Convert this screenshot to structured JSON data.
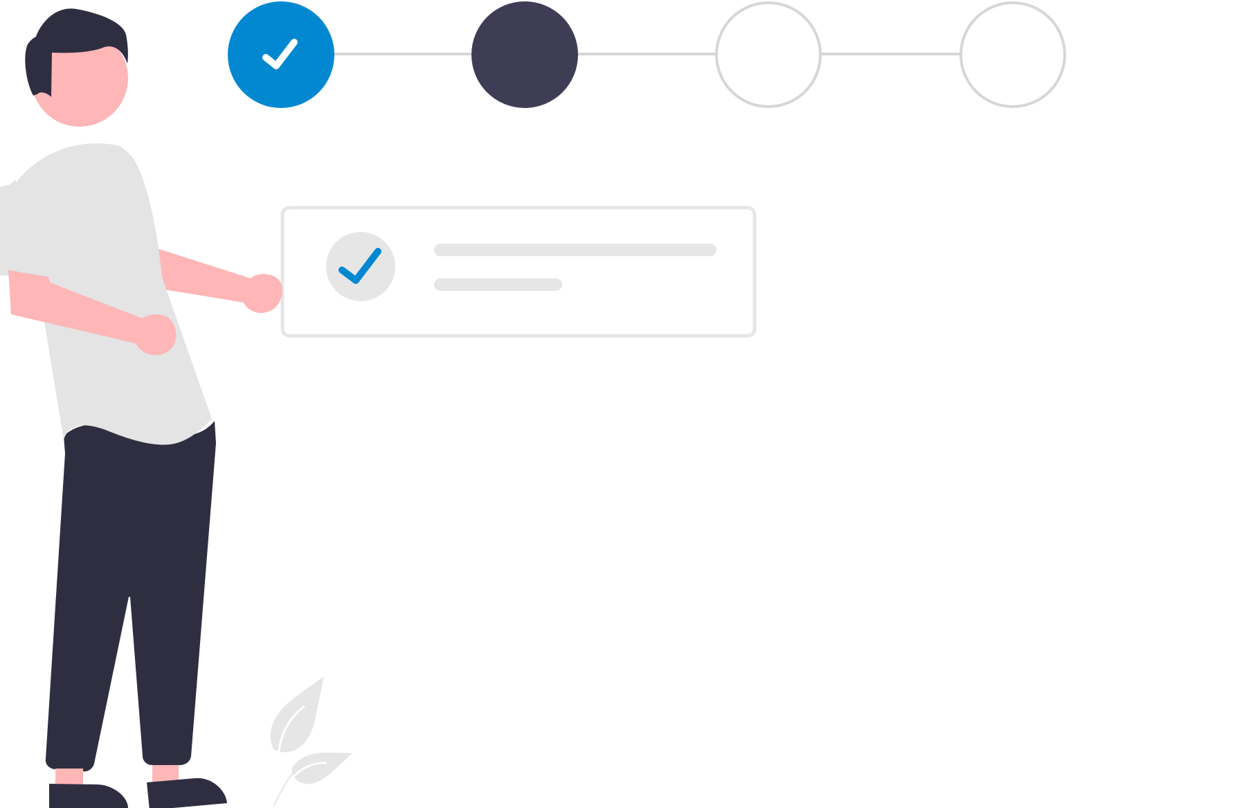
{
  "stepper": {
    "steps": [
      {
        "state": "completed",
        "icon": "check-icon"
      },
      {
        "state": "current",
        "icon": ""
      },
      {
        "state": "upcoming",
        "icon": ""
      },
      {
        "state": "upcoming",
        "icon": ""
      }
    ],
    "current_step": 2,
    "total_steps": 4
  },
  "card": {
    "icon": "check-icon",
    "lines": [
      "placeholder-line-long",
      "placeholder-line-short"
    ]
  },
  "colors": {
    "accent": "#0288d1",
    "current": "#3f3d56",
    "line": "#d6d6d6",
    "placeholder": "#e6e6e6",
    "skin": "#ffb6b6",
    "dark": "#2f2e41",
    "shirt": "#e4e4e4"
  }
}
